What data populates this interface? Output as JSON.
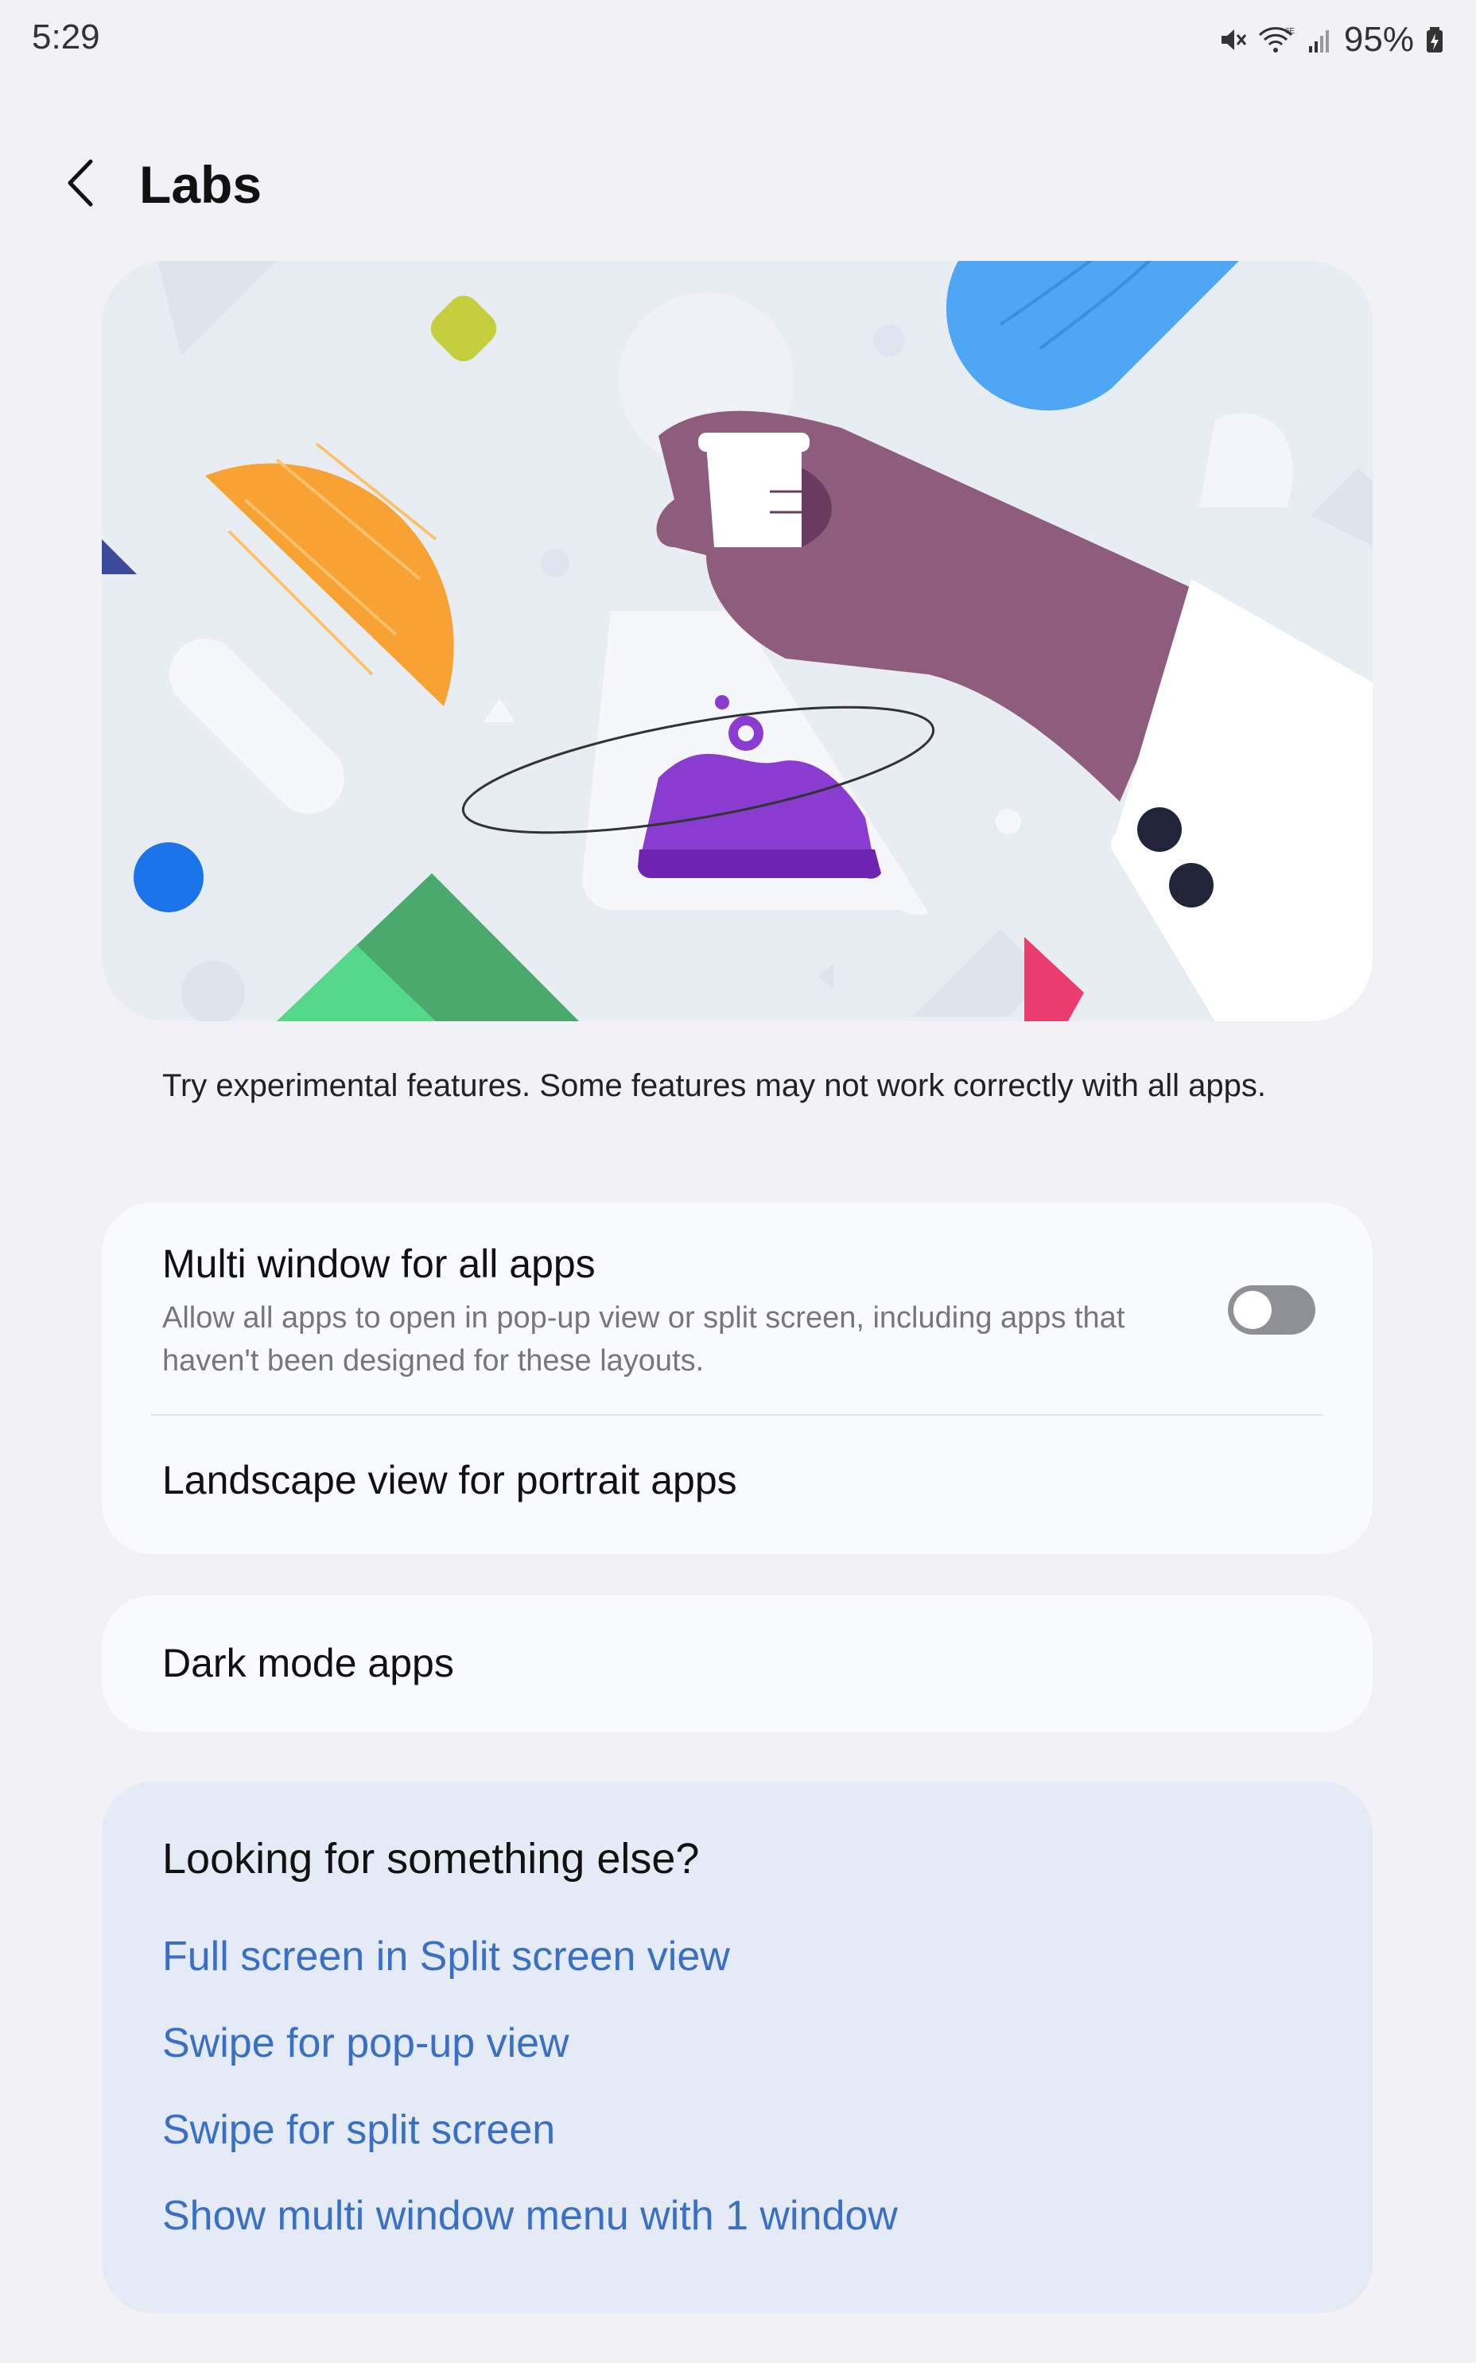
{
  "status_bar": {
    "time": "5:29",
    "battery": "95%",
    "icons": [
      "mute-icon",
      "wifi-6e-icon",
      "signal-icon",
      "battery-charging-icon"
    ]
  },
  "app_bar": {
    "title": "Labs",
    "back_icon": "chevron-left-icon"
  },
  "hero": {
    "illustration": "lab-flask-hand-illustration"
  },
  "description": "Try experimental features. Some features may not work correctly with all apps.",
  "settings": [
    {
      "title": "Multi window for all apps",
      "subtitle": "Allow all apps to open in pop-up view or split screen, including apps that haven't been designed for these layouts.",
      "toggle": false
    },
    {
      "title": "Landscape view for portrait apps"
    },
    {
      "title": "Dark mode apps"
    }
  ],
  "suggestions": {
    "title": "Looking for something else?",
    "links": [
      "Full screen in Split screen view",
      "Swipe for pop-up view",
      "Swipe for split screen",
      "Show multi window menu with 1 window"
    ]
  },
  "colors": {
    "background": "#f2f2f6",
    "card": "#fafbfe",
    "link": "#3a6fc6",
    "suggest_bg": "#e4ebf7"
  }
}
